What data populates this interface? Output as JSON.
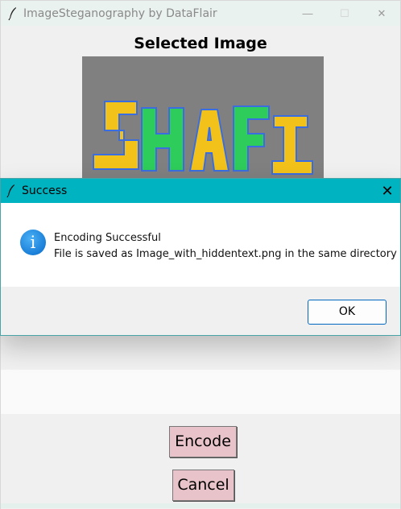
{
  "main_window": {
    "title": "ImageSteganography by DataFlair",
    "controls": {
      "minimize": "—",
      "maximize": "☐",
      "close": "✕"
    },
    "heading": "Selected Image",
    "image_text": "SHAFI",
    "encode_label": "Encode",
    "cancel_label": "Cancel"
  },
  "dialog": {
    "title": "Success",
    "close": "✕",
    "icon_glyph": "i",
    "message_line1": "Encoding Successful",
    "message_line2": "File is saved as Image_with_hiddentext.png in the same directory",
    "ok_label": "OK"
  },
  "colors": {
    "dialog_titlebar": "#00b3c0",
    "button_pink": "#e8c3c9",
    "image_bg": "#808080",
    "text_yellow": "#f2c21a",
    "text_green": "#2ecc5a"
  }
}
